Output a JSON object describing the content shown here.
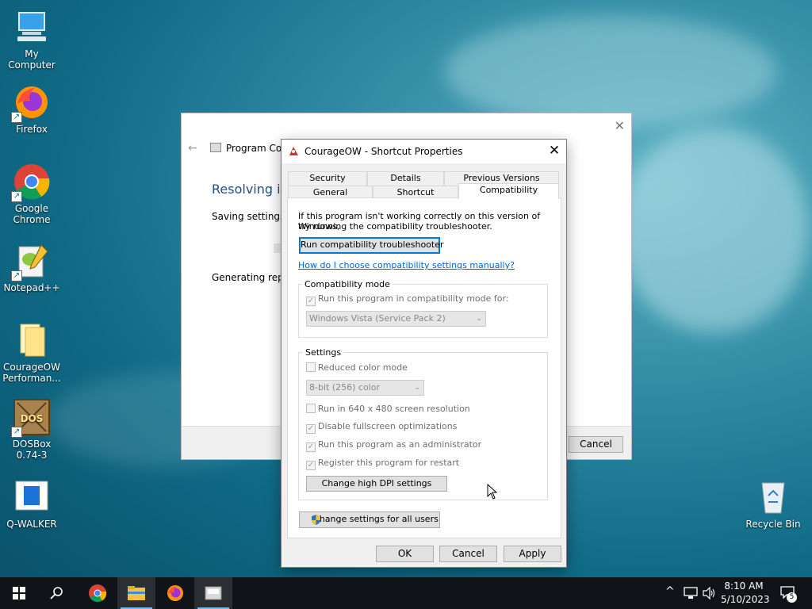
{
  "desktop": {
    "icons": [
      {
        "label": "My Computer"
      },
      {
        "label": "Firefox"
      },
      {
        "label": "Google Chrome"
      },
      {
        "label": "Notepad++"
      },
      {
        "label": "CourageOW Performan..."
      },
      {
        "label": "DOSBox 0.74-3"
      },
      {
        "label": "Q-WALKER"
      },
      {
        "label": "Recycle Bin"
      }
    ]
  },
  "background_window": {
    "title": "Program Con",
    "heading": "Resolving iss",
    "line1": "Saving settings",
    "line2": "Generating repor",
    "cancel_label": "Cancel"
  },
  "dialog": {
    "title": "CourageOW - Shortcut Properties",
    "tabs_row1": [
      "Security",
      "Details",
      "Previous Versions"
    ],
    "tabs_row2": [
      "General",
      "Shortcut",
      "Compatibility"
    ],
    "active_tab": "Compatibility",
    "intro_line1": "If this program isn't working correctly on this version of Windows,",
    "intro_line2": "try running the compatibility troubleshooter.",
    "troubleshooter_button": "Run compatibility troubleshooter",
    "manual_link": "How do I choose compatibility settings manually?",
    "compat_mode": {
      "label": "Compatibility mode",
      "checkbox": "Run this program in compatibility mode for:",
      "checked": true,
      "selected_os": "Windows Vista (Service Pack 2)"
    },
    "settings": {
      "label": "Settings",
      "reduced_color": {
        "label": "Reduced color mode",
        "checked": false
      },
      "color_select": "8-bit (256) color",
      "res_640": {
        "label": "Run in 640 x 480 screen resolution",
        "checked": false
      },
      "disable_fullscreen": {
        "label": "Disable fullscreen optimizations",
        "checked": true
      },
      "run_admin": {
        "label": "Run this program as an administrator",
        "checked": true
      },
      "register_restart": {
        "label": "Register this program for restart",
        "checked": true
      },
      "dpi_button": "Change high DPI settings"
    },
    "all_users_button": "Change settings for all users",
    "ok_label": "OK",
    "cancel_label": "Cancel",
    "apply_label": "Apply"
  },
  "taskbar": {
    "time": "8:10 AM",
    "date": "5/10/2023",
    "notification_count": "5"
  }
}
